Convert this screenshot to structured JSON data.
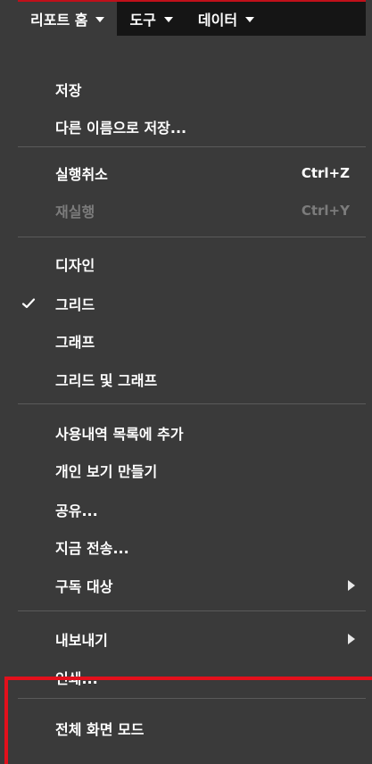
{
  "menubar": {
    "tabs": [
      {
        "label": "리포트 홈"
      },
      {
        "label": "도구"
      },
      {
        "label": "데이터"
      }
    ]
  },
  "menu": {
    "save": "저장",
    "save_as": "다른 이름으로 저장...",
    "undo": "실행취소",
    "undo_shortcut": "Ctrl+Z",
    "redo": "재실행",
    "redo_shortcut": "Ctrl+Y",
    "design": "디자인",
    "grid": "그리드",
    "graph": "그래프",
    "grid_and_graph": "그리드 및 그래프",
    "add_to_history": "사용내역 목록에 추가",
    "create_personal_view": "개인 보기 만들기",
    "share": "공유...",
    "send_now": "지금 전송...",
    "subscribe_to": "구독 대상",
    "export": "내보내기",
    "print": "인쇄...",
    "fullscreen_mode": "전체 화면 모드"
  },
  "state": {
    "checked_item": "grid",
    "disabled_item": "redo"
  },
  "colors": {
    "menu_bg": "#3a3a3a",
    "menubar_bg": "#151515",
    "accent_red": "#e3101c",
    "text": "#ffffff",
    "disabled_text": "#7c7c7c"
  }
}
